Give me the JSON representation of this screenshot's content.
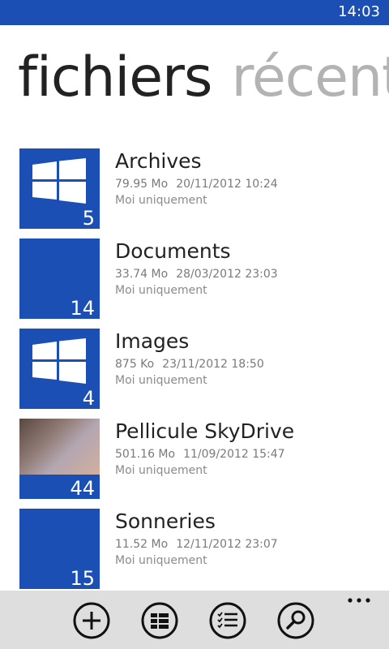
{
  "status": {
    "time": "14:03"
  },
  "pivot": {
    "active": "fichiers",
    "inactive": "récent"
  },
  "items": [
    {
      "name": "Archives",
      "size": "79.95 Mo",
      "datetime": "20/11/2012 10:24",
      "sharing": "Moi uniquement",
      "count": "5",
      "thumb": "windows-logo"
    },
    {
      "name": "Documents",
      "size": "33.74 Mo",
      "datetime": "28/03/2012 23:03",
      "sharing": "Moi uniquement",
      "count": "14",
      "thumb": "plain"
    },
    {
      "name": "Images",
      "size": "875 Ko",
      "datetime": "23/11/2012 18:50",
      "sharing": "Moi uniquement",
      "count": "4",
      "thumb": "windows-logo"
    },
    {
      "name": "Pellicule SkyDrive",
      "size": "501.16 Mo",
      "datetime": "11/09/2012 15:47",
      "sharing": "Moi uniquement",
      "count": "44",
      "thumb": "photo"
    },
    {
      "name": "Sonneries",
      "size": "11.52 Mo",
      "datetime": "12/11/2012 23:07",
      "sharing": "Moi uniquement",
      "count": "15",
      "thumb": "plain"
    }
  ],
  "appbar": {
    "buttons": [
      "add-icon",
      "grid-view-icon",
      "select-list-icon",
      "search-icon"
    ],
    "more": "more-icon"
  },
  "colors": {
    "accent": "#1b4fb3",
    "appbar": "#dedede",
    "inactive_pivot": "#b3b3b3"
  }
}
